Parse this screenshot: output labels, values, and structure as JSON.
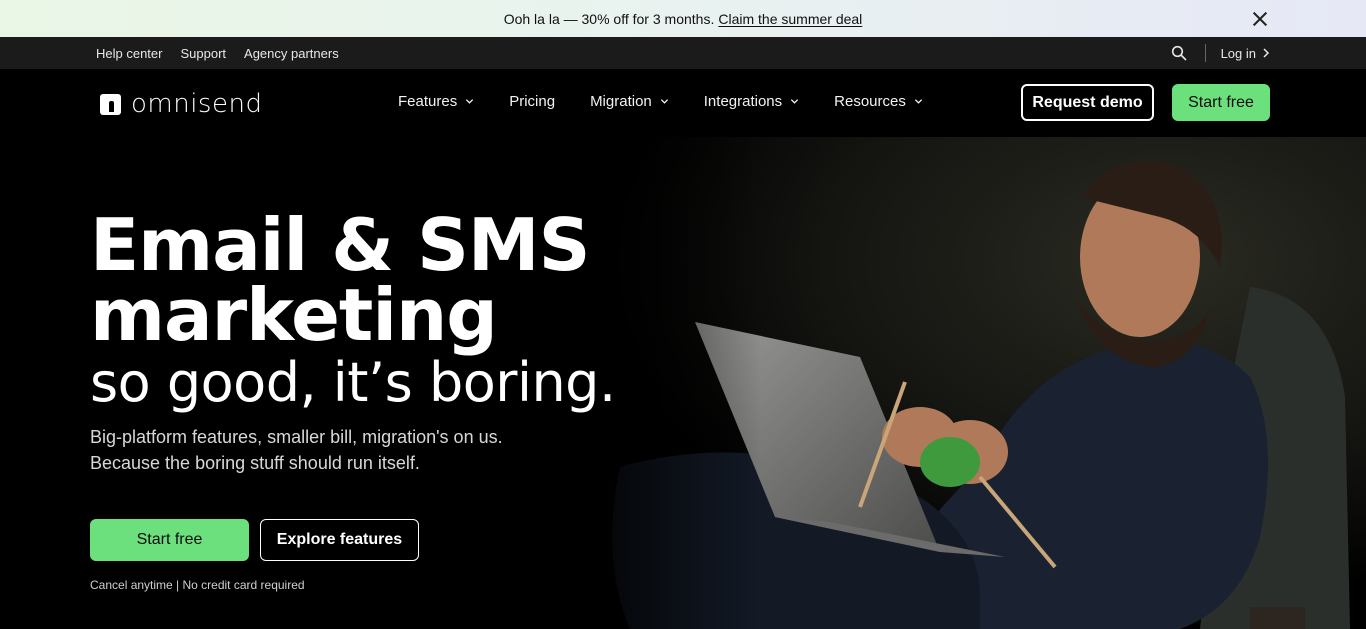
{
  "promo": {
    "message": "Ooh la la — 30% off for 3 months.",
    "link": "Claim the summer deal",
    "close_icon": "close-icon"
  },
  "utility": {
    "links": [
      "Help center",
      "Support",
      "Agency partners"
    ],
    "search_icon": "search-icon",
    "login": "Log in"
  },
  "nav": {
    "brand": "omnisend",
    "menu": [
      {
        "label": "Features",
        "dropdown": true
      },
      {
        "label": "Pricing",
        "dropdown": false
      },
      {
        "label": "Migration",
        "dropdown": true
      },
      {
        "label": "Integrations",
        "dropdown": true
      },
      {
        "label": "Resources",
        "dropdown": true
      }
    ],
    "request_demo": "Request demo",
    "start_free": "Start free"
  },
  "hero": {
    "headline_line1": "Email & SMS",
    "headline_line2": "marketing",
    "headline_line3": "so good, it’s boring.",
    "sub_line1": "Big-platform features, smaller bill, migration's on us.",
    "sub_line2": "Because the boring stuff should run itself.",
    "cta_primary": "Start free",
    "cta_secondary": "Explore features",
    "fine_print": "Cancel anytime | No credit card required"
  },
  "colors": {
    "accent_green": "#6be07c",
    "background": "#000000",
    "util_bar": "#1b1b1b"
  }
}
